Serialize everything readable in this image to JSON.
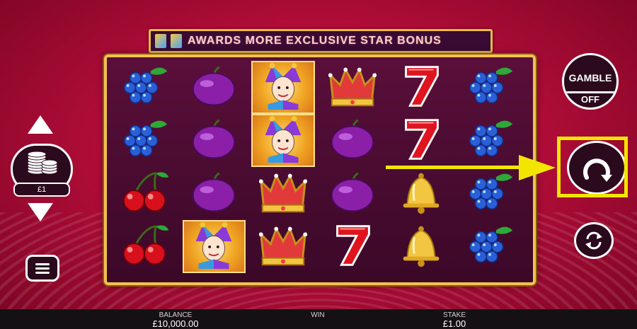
{
  "banner": {
    "text": "AWARDS MORE EXCLUSIVE STAR BONUS"
  },
  "reels": [
    [
      "grapes",
      "grapes",
      "cherries",
      "cherries"
    ],
    [
      "plum",
      "plum",
      "plum",
      "joker"
    ],
    [
      "joker",
      "joker",
      "crown",
      "crown"
    ],
    [
      "crown",
      "plum",
      "plum",
      "seven"
    ],
    [
      "seven",
      "seven",
      "bell",
      "bell"
    ],
    [
      "grapes",
      "grapes",
      "grapes",
      "grapes"
    ]
  ],
  "controls": {
    "stake_value": "£1",
    "gamble_label": "GAMBLE",
    "gamble_state": "OFF",
    "icons": [
      "arrow-up-icon",
      "coin-stack-icon",
      "arrow-down-icon",
      "menu-icon",
      "spin-icon",
      "autoplay-icon"
    ]
  },
  "bottom_bar": {
    "balance_label": "BALANCE",
    "balance_value": "£10,000.00",
    "win_label": "WIN",
    "win_value": "",
    "stake_label": "STAKE",
    "stake_value": "£1.00"
  },
  "colors": {
    "background": "#b40d3a",
    "frame_gold": "#f1c24f",
    "highlight_yellow": "#f2e600",
    "reel_bg": "#4a0c32"
  }
}
